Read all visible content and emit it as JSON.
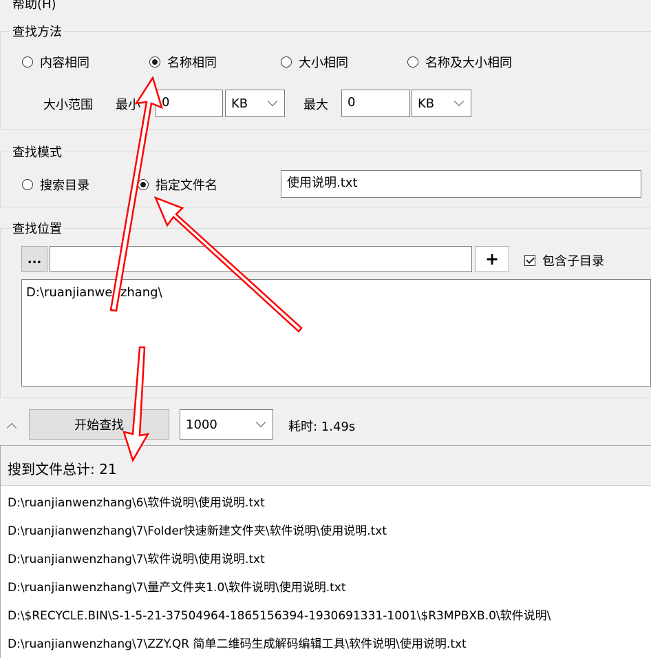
{
  "menu": {
    "help": "帮助(H)"
  },
  "find_method": {
    "legend": "查找方法",
    "options": [
      "内容相同",
      "名称相同",
      "大小相同",
      "名称及大小相同"
    ],
    "selected": 1,
    "size_range_label": "大小范围",
    "min_label": "最小",
    "min_value": "0",
    "min_unit": "KB",
    "max_label": "最大",
    "max_value": "0",
    "max_unit": "KB"
  },
  "find_mode": {
    "legend": "查找模式",
    "options": [
      "搜索目录",
      "指定文件名"
    ],
    "selected": 1,
    "filename_value": "使用说明.txt"
  },
  "find_location": {
    "legend": "查找位置",
    "browse_label": "...",
    "path_input_value": "",
    "add_label": "+",
    "include_subdirs_label": "包含子目录",
    "include_subdirs_checked": true,
    "paths": [
      "D:\\ruanjianwenzhang\\"
    ]
  },
  "controls": {
    "start_label": "开始查找",
    "limit_value": "1000",
    "elapsed": "耗时: 1.49s"
  },
  "results": {
    "summary": "搜到文件总计: 21",
    "rows": [
      "D:\\ruanjianwenzhang\\6\\软件说明\\使用说明.txt",
      "D:\\ruanjianwenzhang\\7\\Folder快速新建文件夹\\软件说明\\使用说明.txt",
      "D:\\ruanjianwenzhang\\7\\软件说明\\使用说明.txt",
      "D:\\ruanjianwenzhang\\7\\量产文件夹1.0\\软件说明\\使用说明.txt",
      "D:\\$RECYCLE.BIN\\S-1-5-21-37504964-1865156394-1930691331-1001\\$R3MPBXB.0\\软件说明\\",
      "D:\\ruanjianwenzhang\\7\\ZZY.QR 简单二维码生成解码编辑工具\\软件说明\\使用说明.txt"
    ]
  },
  "colors": {
    "annotation_arrow": "#ff0000"
  }
}
